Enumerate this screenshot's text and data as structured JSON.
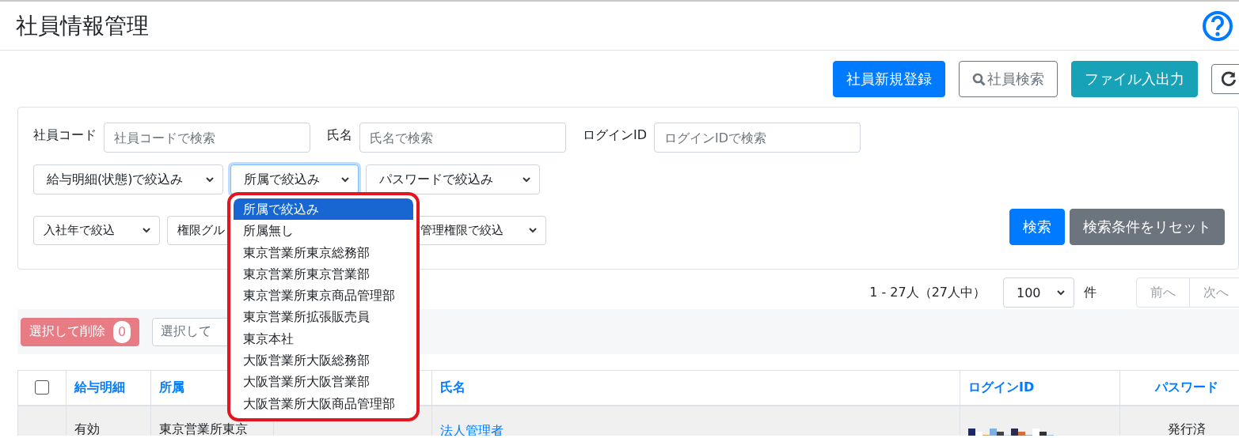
{
  "page": {
    "title": "社員情報管理"
  },
  "toolbar": [
    {
      "label": "社員新規登録",
      "kind": "primary"
    },
    {
      "label": "社員検索",
      "kind": "search"
    },
    {
      "label": "ファイル入出力",
      "kind": "info"
    },
    {
      "kind": "refresh"
    }
  ],
  "filters": {
    "text_fields": [
      {
        "label": "社員コード",
        "placeholder": "社員コードで検索"
      },
      {
        "label": "氏名",
        "placeholder": "氏名で検索"
      },
      {
        "label": "ログインID",
        "placeholder": "ログインIDで検索"
      }
    ],
    "selects_row1": [
      {
        "value": "給与明細(状態)で絞込み",
        "expanded": false,
        "arrow": true
      },
      {
        "value": "所属で絞込み",
        "expanded": true,
        "arrow": true,
        "options": [
          {
            "label": "所属で絞込み",
            "selected": true
          },
          {
            "label": "所属無し",
            "selected": false
          },
          {
            "label": "東京営業所東京総務部",
            "selected": false
          },
          {
            "label": "東京営業所東京営業部",
            "selected": false
          },
          {
            "label": "東京営業所東京商品管理部",
            "selected": false
          },
          {
            "label": "東京営業所拡張販売員",
            "selected": false
          },
          {
            "label": "東京本社",
            "selected": false
          },
          {
            "label": "大阪営業所大阪総務部",
            "selected": false
          },
          {
            "label": "大阪営業所大阪営業部",
            "selected": false
          },
          {
            "label": "大阪営業所大阪商品管理部",
            "selected": false
          }
        ]
      },
      {
        "value": "パスワードで絞込み",
        "expanded": false,
        "arrow": true
      }
    ],
    "selects_row2": [
      {
        "value": "入社年で絞込",
        "expanded": false,
        "arrow": true
      },
      {
        "value": "権限グル",
        "expanded": false,
        "arrow": false
      },
      {
        "value": "管理権限で絞込",
        "expanded": false,
        "arrow": true
      }
    ],
    "buttons": [
      {
        "label": "検索",
        "kind": "primary"
      },
      {
        "label": "検索条件をリセット",
        "kind": "secondary"
      }
    ]
  },
  "pagination": {
    "summary": "1 - 27人（27人中）",
    "page_size": "100",
    "unit": "件",
    "prev": {
      "label": "前へ",
      "disabled": true
    },
    "next": {
      "label": "次へ",
      "disabled": true
    }
  },
  "bulk_actions": [
    {
      "label": "選択して削除",
      "count": "0",
      "kind": "danger"
    },
    {
      "label": "選択して",
      "kind": "outline"
    }
  ],
  "table": {
    "columns": [
      {
        "kind": "checkbox",
        "checked": false
      },
      {
        "kind": "text",
        "label": "給与明細"
      },
      {
        "kind": "text",
        "label": "所属"
      },
      {
        "kind": "empty"
      },
      {
        "kind": "text",
        "label": "氏名"
      },
      {
        "kind": "text",
        "label": "ログインID"
      },
      {
        "kind": "text",
        "label": "パスワード"
      }
    ],
    "rows": [
      {
        "cells": [
          {
            "kind": "empty"
          },
          {
            "kind": "text",
            "text": "有効"
          },
          {
            "kind": "text",
            "text": "東京営業所東京"
          },
          {
            "kind": "empty"
          },
          {
            "kind": "link",
            "text": "法人管理者"
          },
          {
            "kind": "picture"
          },
          {
            "kind": "text",
            "text": "発行済"
          }
        ]
      }
    ]
  }
}
